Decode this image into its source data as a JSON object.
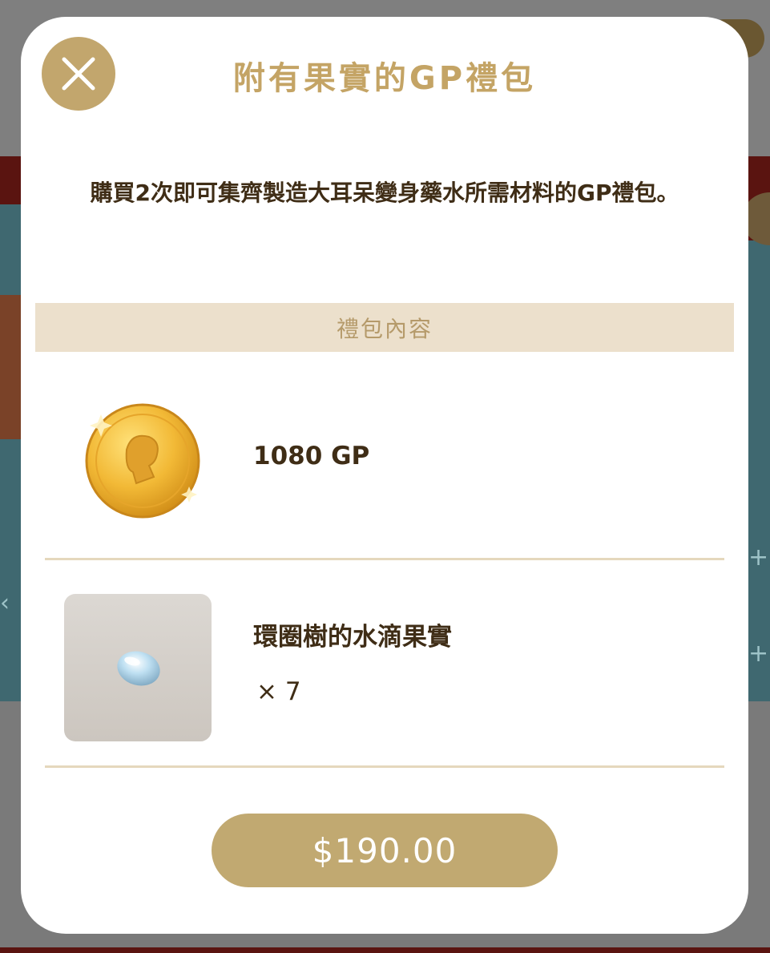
{
  "modal": {
    "title": "附有果實的GP禮包",
    "description": "購買2次即可集齊製造大耳呆變身藥水所需材料的GP禮包。",
    "close_icon": "close-icon",
    "section_header": "禮包內容",
    "items": [
      {
        "name": "1080 GP",
        "icon": "gold-coin-icon"
      },
      {
        "name": "環圈樹的水滴果實",
        "quantity": "× 7",
        "icon": "water-drop-fruit-icon"
      }
    ],
    "price_label": "$190.00"
  },
  "colors": {
    "accent_gold": "#c2a66d",
    "title_gold": "#c4a465",
    "text_brown": "#3f2d16",
    "section_bg": "#ece0cc",
    "divider": "#e5d8bd",
    "price_button": "#c1a971"
  }
}
